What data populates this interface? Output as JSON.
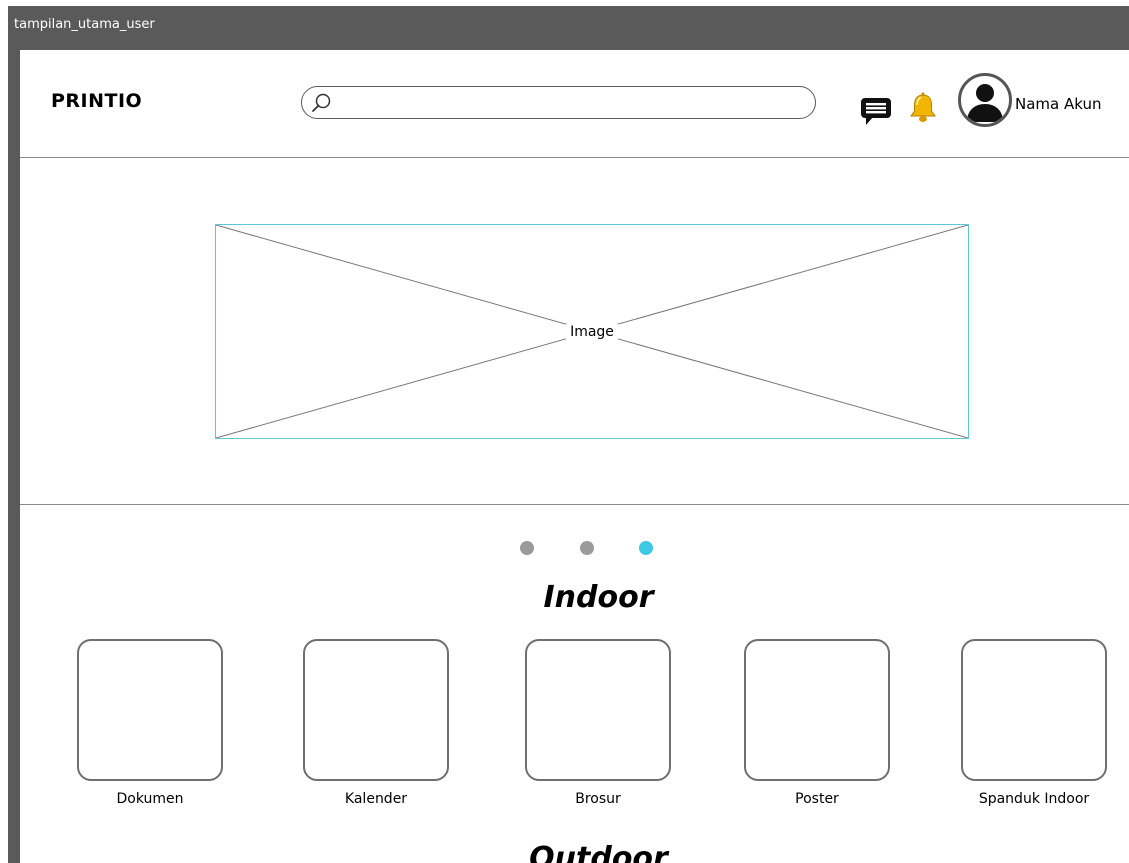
{
  "window": {
    "title": "tampilan_utama_user"
  },
  "header": {
    "logo": "PRINTIO",
    "search": {
      "value": "",
      "placeholder": ""
    },
    "icons": {
      "chat": "chat-icon",
      "notification": "bell-icon",
      "avatar": "user-avatar-icon"
    },
    "account_name": "Nama Akun"
  },
  "banner": {
    "placeholder_label": "Image"
  },
  "carousel": {
    "dot_count": 3,
    "active_index": 2,
    "active_color": "#3dc8e4",
    "inactive_color": "#9a9a9a"
  },
  "indoor": {
    "heading": "Indoor",
    "categories": [
      {
        "label": "Dokumen"
      },
      {
        "label": "Kalender"
      },
      {
        "label": "Brosur"
      },
      {
        "label": "Poster"
      },
      {
        "label": "Spanduk Indoor"
      }
    ]
  },
  "outdoor": {
    "heading": "Outdoor"
  },
  "colors": {
    "frame": "#5a5a5a",
    "accent": "#3dc8e4",
    "bell": "#f2b500",
    "banner_border": "#5bc8d6"
  }
}
